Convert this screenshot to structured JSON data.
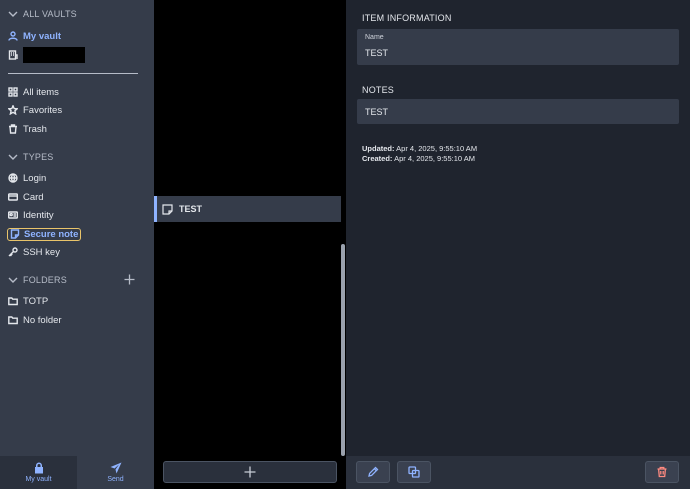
{
  "sidebar": {
    "all_vaults": "ALL VAULTS",
    "my_vault": "My vault",
    "all_items": "All items",
    "favorites": "Favorites",
    "trash": "Trash",
    "types_heading": "TYPES",
    "types": {
      "login": "Login",
      "card": "Card",
      "identity": "Identity",
      "secure_note": "Secure note",
      "ssh_key": "SSH key"
    },
    "folders_heading": "FOLDERS",
    "folders": {
      "totp": "TOTP",
      "no_folder": "No folder"
    }
  },
  "bottom_nav": {
    "my_vault": "My vault",
    "send": "Send"
  },
  "list": {
    "items": [
      {
        "name": "TEST"
      }
    ]
  },
  "detail": {
    "item_information": "ITEM INFORMATION",
    "name_label": "Name",
    "name_value": "TEST",
    "notes_heading": "NOTES",
    "notes_value": "TEST",
    "updated_label": "Updated:",
    "updated_value": "Apr 4, 2025, 9:55:10 AM",
    "created_label": "Created:",
    "created_value": "Apr 4, 2025, 9:55:10 AM"
  },
  "colors": {
    "accent": "#8fb3ff",
    "highlight_outline": "#e9c46a",
    "danger": "#ff8a80",
    "sidebar_bg": "#353c4a",
    "detail_bg": "#1f242e"
  }
}
